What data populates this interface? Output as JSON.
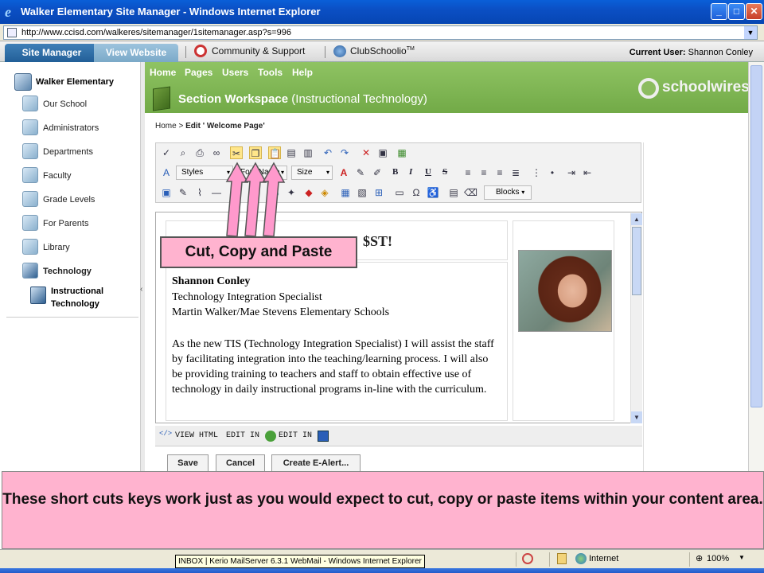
{
  "window": {
    "title": "Walker Elementary Site Manager - Windows Internet Explorer",
    "url": "http://www.ccisd.com/walkeres/sitemanager/1sitemanager.asp?s=996",
    "min": "_",
    "max": "□",
    "close": "✕"
  },
  "topbar": {
    "tab_site_manager": "Site Manager",
    "tab_view_website": "View Website",
    "community_link": "Community & Support",
    "club_link": "ClubSchoolio",
    "club_tm": "TM",
    "current_user_label": "Current User:",
    "current_user_name": "Shannon Conley"
  },
  "sidebar": {
    "root": "Walker Elementary",
    "items": [
      {
        "label": "Our School"
      },
      {
        "label": "Administrators"
      },
      {
        "label": "Departments"
      },
      {
        "label": "Faculty"
      },
      {
        "label": "Grade Levels"
      },
      {
        "label": "For Parents"
      },
      {
        "label": "Library"
      },
      {
        "label": "Technology"
      }
    ],
    "sub_item": "Instructional Technology",
    "collapse": "‹"
  },
  "nav": {
    "home": "Home",
    "pages": "Pages",
    "users": "Users",
    "tools": "Tools",
    "help": "Help"
  },
  "workspace": {
    "title": "Section Workspace",
    "subtitle": "(Instructional Technology)",
    "logo": "schoolwires",
    "logo_reg": "®"
  },
  "breadcrumb": {
    "home": "Home",
    "sep": ">",
    "current": "Edit ' Welcome Page'"
  },
  "toolbar": {
    "styles": "Styles",
    "font": "Font Name",
    "size": "Size",
    "blocks": "Blocks",
    "arrow": "▾",
    "bold": "B",
    "italic": "I",
    "underline": "U",
    "strike": "S"
  },
  "content": {
    "heading": "$ST!",
    "name": "Shannon Conley",
    "title": "Technology Integration Specialist",
    "school": "Martin Walker/Mae Stevens Elementary Schools",
    "bio": "As the new TIS (Technology Integration Specialist) I will assist the staff by facilitating integration into the teaching/learning process. I will also be providing training to teachers and staff to obtain effective use of technology in daily instructional programs in-line with the curriculum."
  },
  "modes": {
    "view_html": "VIEW HTML",
    "edit_in_1": "EDIT IN",
    "edit_in_2": "EDIT IN"
  },
  "actions": {
    "save": "Save",
    "cancel": "Cancel",
    "alert": "Create E-Alert..."
  },
  "callout": "Cut, Copy and Paste",
  "note": "These short cuts keys work just as you would expect to cut, copy or paste items within your content area.",
  "statusbar": {
    "internet": "Internet",
    "zoom": "100%",
    "taskbar_tip": "INBOX | Kerio MailServer 6.3.1 WebMail - Windows Internet Explorer"
  },
  "colors": {
    "accent_green": "#7fb552",
    "callout_pink": "#ffb3cf",
    "arrow_pink": "#ff99cc",
    "title_blue": "#0a5fd8"
  }
}
